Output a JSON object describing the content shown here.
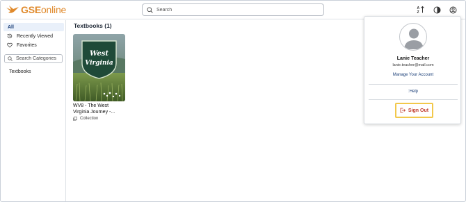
{
  "header": {
    "logo_brand": "GSE",
    "logo_suffix": "online",
    "search_placeholder": "Search",
    "icons": [
      "sort-az-icon",
      "contrast-icon",
      "account-icon"
    ]
  },
  "sidebar": {
    "items": [
      {
        "label": "All",
        "active": true
      },
      {
        "label": "Recently Viewed",
        "icon": "history-icon"
      },
      {
        "label": "Favorites",
        "icon": "heart-icon"
      }
    ],
    "category_search_placeholder": "Search Categories",
    "categories": [
      {
        "label": "Textbooks"
      }
    ]
  },
  "main": {
    "section_title": "Textbooks (1)",
    "cards": [
      {
        "cover_text": "West Virginia",
        "title": "WV8 - The West Virginia Journey -...",
        "meta": "Collection"
      }
    ]
  },
  "account_menu": {
    "name": "Lanie Teacher",
    "email": "lanie.teacher@mail.com",
    "manage_label": "Manage Your Account",
    "help_label": ":Help",
    "signout_label": "Sign Out"
  },
  "colors": {
    "brand_orange": "#e08a2c",
    "nav_active_bg": "#e9f0fa",
    "link_blue": "#1b3f78",
    "signout_red": "#c0392b",
    "highlight_yellow": "#f2c84b"
  }
}
